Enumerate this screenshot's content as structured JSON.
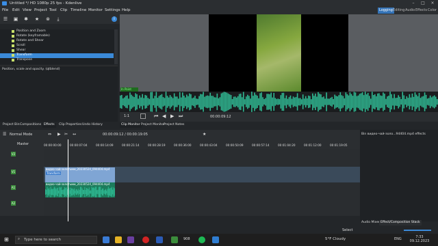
{
  "window": {
    "title": "Untitled */ HD 1080p 25 fps - Kdenlive"
  },
  "menu": [
    "File",
    "Edit",
    "View",
    "Project",
    "Tool",
    "Clip",
    "Timeline",
    "Monitor",
    "Settings",
    "Help"
  ],
  "layouts": [
    "Logging",
    "Editing",
    "Audio",
    "Effects",
    "Color"
  ],
  "active_layout": "Logging",
  "effects": [
    {
      "label": "Position and Zoom"
    },
    {
      "label": "Rotate (keyframable)"
    },
    {
      "label": "Rotate and Shear"
    },
    {
      "label": "Scroll"
    },
    {
      "label": "Shear"
    },
    {
      "label": "Transform",
      "selected": true
    },
    {
      "label": "Transpose"
    }
  ],
  "effect_description": "Position, scale and opacity. (qtblend)",
  "monitor": {
    "clip_overlay": "In Point",
    "zoom": "1:1"
  },
  "timecode": {
    "current": "00:00:09:12",
    "total": "00:00:19:05"
  },
  "left_tabs": [
    "Project Bin",
    "Compositions",
    "Effects",
    "Clip Properties",
    "Undo History"
  ],
  "left_active": "Effects",
  "right_tabs": [
    "Clip Monitor",
    "Project Monitor",
    "Project Notes"
  ],
  "right_active": "Clip Monitor",
  "timeline": {
    "mode": "Normal Mode",
    "master": "Master",
    "ruler": [
      "00:00:00:00",
      "00:00:07:04",
      "00:00:14:09",
      "00:00:21:14",
      "00:00:28:19",
      "00:00:36:00",
      "00:00:43:04",
      "00:00:50:09",
      "00:00:57:14",
      "00:01:04:20",
      "00:01:12:00",
      "00:01:19:05"
    ],
    "tracks": [
      "V2",
      "V1",
      "A1",
      "A2"
    ],
    "video_clip_name": "видео-чай-золотыми_20230524_094404.mp4",
    "audio_clip_name": "видео-чай-золотыми_20230524_094404.mp4",
    "transform_badge": "Transform"
  },
  "effect_panel": {
    "title": "Bin видео-чай-золо...94404.mp4 effects"
  },
  "bottom_tabs": [
    "Audio Mixer",
    "Effect/Composition Stack"
  ],
  "select_label": "Select",
  "taskbar": {
    "search_placeholder": "Type here to search",
    "weather": "5°F  Cloudy",
    "lang": "ENG",
    "time": "7:33",
    "date": "09.12.2023",
    "badge": "908"
  },
  "colors": {
    "accent": "#3b8ad8",
    "audio": "#2fb892",
    "track": "#3c8d3c"
  }
}
